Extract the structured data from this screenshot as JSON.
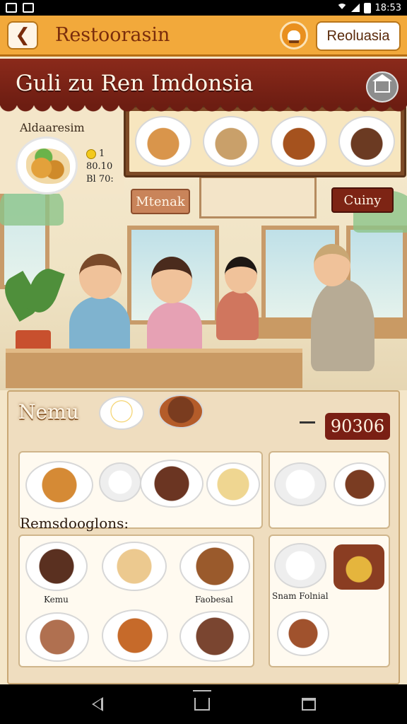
{
  "status_bar": {
    "time": "18:53"
  },
  "app_bar": {
    "title": "Restoorasin",
    "reservation_label": "Reoluasia"
  },
  "banner": {
    "title": "Guli zu Ren Imdonsia"
  },
  "scene": {
    "side_label": "Aldaaresim",
    "side_info": [
      "1",
      "80.10",
      "Bl 70:"
    ],
    "sign_left": "Mtenak",
    "sign_right": "Cuiny"
  },
  "menu": {
    "title": "Nemu",
    "price": "90306",
    "recommendations_title": "Remsdooglons:",
    "dish_labels": {
      "a": "Kemu",
      "b": "Faobesal",
      "c": "Snam Folnial"
    }
  },
  "colors": {
    "accent": "#f2a93b",
    "brand_dark": "#7a1f14",
    "cream": "#f4e6c9"
  },
  "icons": [
    "back-arrow-icon",
    "chef-icon",
    "home-icon",
    "wifi-icon",
    "signal-icon",
    "battery-icon"
  ]
}
